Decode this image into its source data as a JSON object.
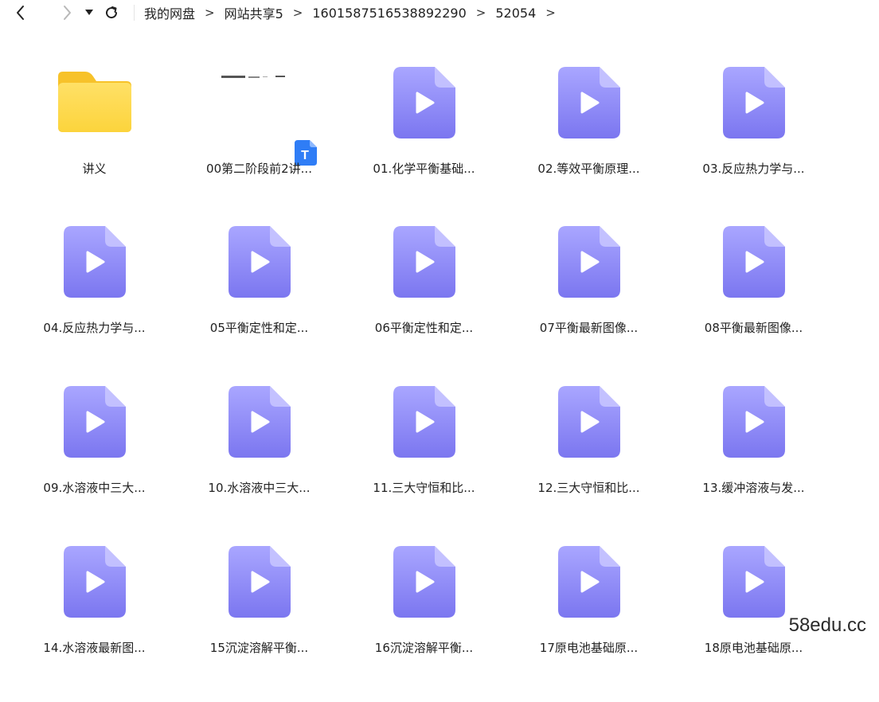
{
  "toolbar": {
    "back_icon": "chevron-left-icon",
    "forward_icon": "chevron-right-icon",
    "dropdown_icon": "caret-down-icon",
    "refresh_icon": "refresh-icon"
  },
  "breadcrumb": {
    "items": [
      "我的网盘",
      "网站共享5",
      "1601587516538892290",
      "52054"
    ],
    "separator": ">"
  },
  "files": [
    {
      "name": "讲义",
      "type": "folder"
    },
    {
      "name": "00第二阶段前2讲...",
      "type": "doc"
    },
    {
      "name": "01.化学平衡基础...",
      "type": "video"
    },
    {
      "name": "02.等效平衡原理...",
      "type": "video"
    },
    {
      "name": "03.反应热力学与...",
      "type": "video"
    },
    {
      "name": "04.反应热力学与...",
      "type": "video"
    },
    {
      "name": "05平衡定性和定...",
      "type": "video"
    },
    {
      "name": "06平衡定性和定...",
      "type": "video"
    },
    {
      "name": "07平衡最新图像...",
      "type": "video"
    },
    {
      "name": "08平衡最新图像...",
      "type": "video"
    },
    {
      "name": "09.水溶液中三大...",
      "type": "video"
    },
    {
      "name": "10.水溶液中三大...",
      "type": "video"
    },
    {
      "name": "11.三大守恒和比...",
      "type": "video"
    },
    {
      "name": "12.三大守恒和比...",
      "type": "video"
    },
    {
      "name": "13.缓冲溶液与发...",
      "type": "video"
    },
    {
      "name": "14.水溶液最新图...",
      "type": "video"
    },
    {
      "name": "15沉淀溶解平衡...",
      "type": "video"
    },
    {
      "name": "16沉淀溶解平衡...",
      "type": "video"
    },
    {
      "name": "17原电池基础原...",
      "type": "video"
    },
    {
      "name": "18原电池基础原...",
      "type": "video"
    }
  ],
  "doc_badge_letter": "T",
  "watermark": "58edu.cc",
  "colors": {
    "video_icon_top": "#a9a6ff",
    "video_icon_bottom": "#7b76f0",
    "folder": "#ffd84d",
    "doc_badge": "#2f7df6"
  }
}
